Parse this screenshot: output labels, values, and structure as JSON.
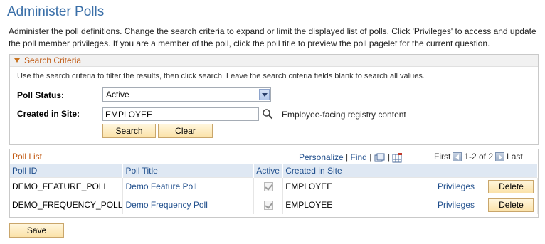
{
  "page": {
    "title": "Administer Polls",
    "description": "Administer the poll definitions. Change the search criteria to expand or limit the displayed list of polls. Click 'Privileges' to access and update the poll member privileges. If you are a member of the poll, click the poll title to preview the poll pagelet for the current question."
  },
  "search": {
    "header": "Search Criteria",
    "help": "Use the search criteria to filter the results, then click search. Leave the search criteria fields blank to search all values.",
    "poll_status_label": "Poll Status:",
    "poll_status_value": "Active",
    "site_label": "Created in Site:",
    "site_value": "EMPLOYEE",
    "site_description": "Employee-facing registry content",
    "search_button": "Search",
    "clear_button": "Clear"
  },
  "grid": {
    "title": "Poll List",
    "personalize": "Personalize",
    "separator": "|",
    "find": "Find",
    "first": "First",
    "range": "1-2 of 2",
    "last": "Last",
    "columns": [
      "Poll ID",
      "Poll Title",
      "Active",
      "Created in Site",
      "",
      ""
    ],
    "rows": [
      {
        "poll_id": "DEMO_FEATURE_POLL",
        "poll_title": "Demo Feature Poll",
        "active": true,
        "site": "EMPLOYEE",
        "privileges": "Privileges",
        "delete": "Delete"
      },
      {
        "poll_id": "DEMO_FREQUENCY_POLL",
        "poll_title": "Demo Frequency Poll",
        "active": true,
        "site": "EMPLOYEE",
        "privileges": "Privileges",
        "delete": "Delete"
      }
    ]
  },
  "footer": {
    "save_button": "Save"
  },
  "colors": {
    "title_blue": "#3a6fa8",
    "section_orange": "#c05810",
    "link_blue": "#1f4e8c",
    "button_yellow": "#fbe2a9"
  }
}
